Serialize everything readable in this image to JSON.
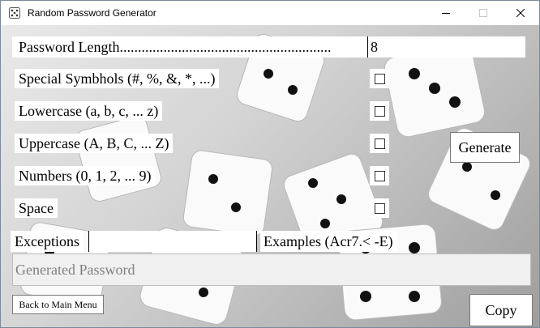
{
  "window": {
    "title": "Random Password Generator",
    "icon": "dice-icon"
  },
  "form": {
    "length_label": "Password Length..........................................................",
    "length_value": "8",
    "options": [
      {
        "label": "Special Symbhols (#, %, &, *, ...)",
        "checked": false
      },
      {
        "label": "Lowercase (a, b, c, ... z)",
        "checked": false
      },
      {
        "label": "Uppercase (A, B, C, ... Z)",
        "checked": false
      },
      {
        "label": "Numbers (0, 1, 2, ... 9)",
        "checked": false
      },
      {
        "label": "Space",
        "checked": false
      }
    ],
    "exceptions_label": "Exceptions",
    "examples_label": "Examples (Acr7.< -E)",
    "generated_placeholder": "Generated Password"
  },
  "buttons": {
    "generate": "Generate",
    "back": "Back to Main Menu",
    "copy": "Copy"
  }
}
